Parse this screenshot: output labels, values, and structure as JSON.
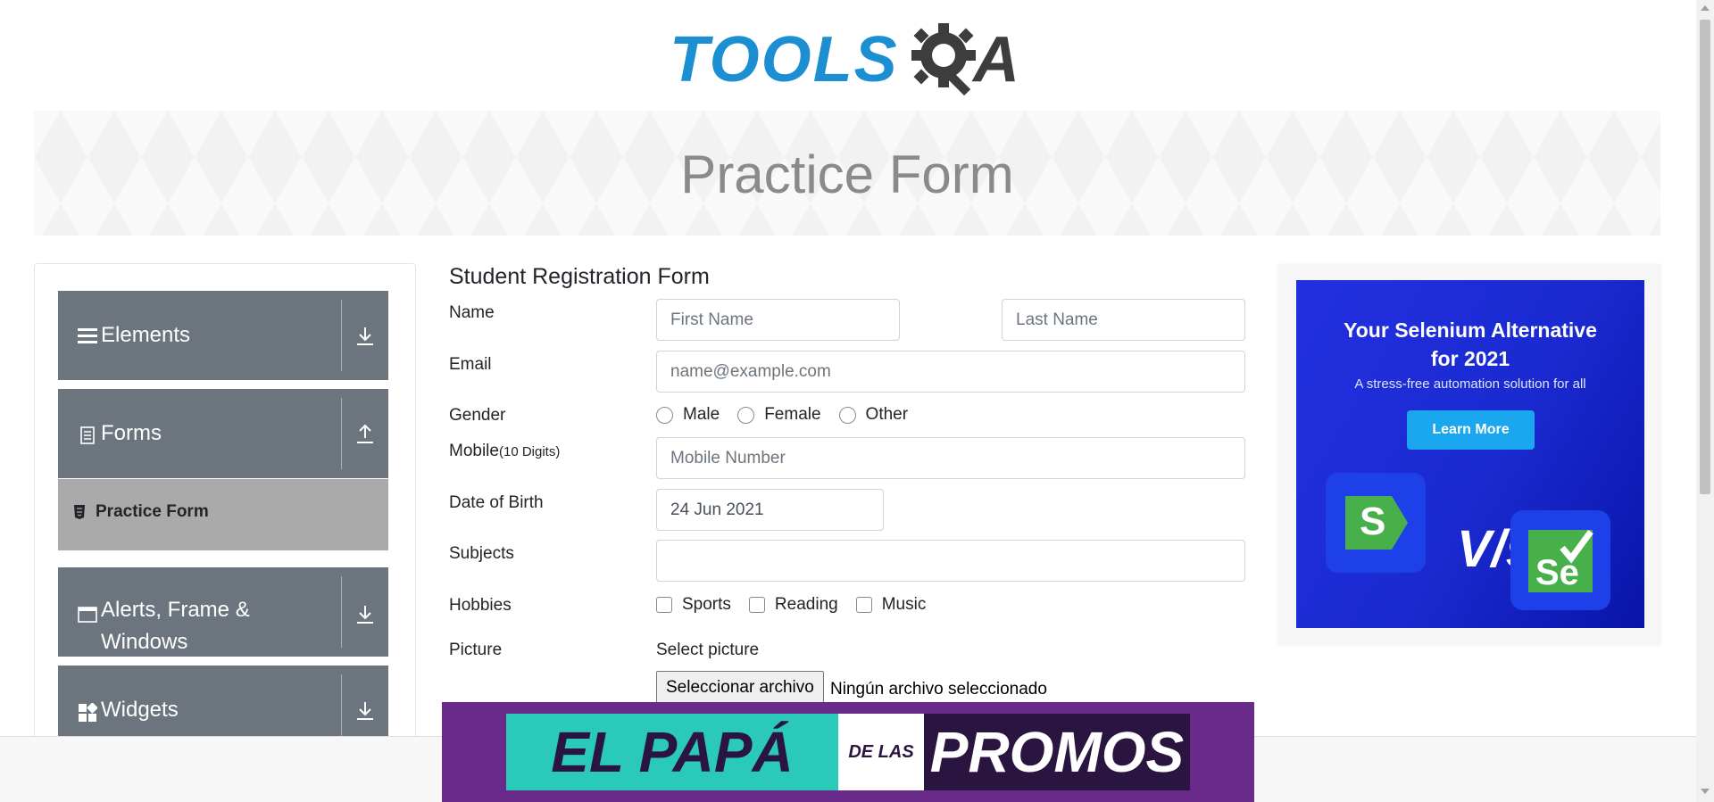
{
  "header": {
    "logo_text_left": "TOOLS",
    "logo_text_right": "A",
    "banner_title": "Practice Form"
  },
  "sidebar": {
    "groups": [
      {
        "label": "Elements",
        "icon": "hamburger-icon",
        "arrow": "download-arrow-icon"
      },
      {
        "label": "Forms",
        "icon": "document-icon",
        "arrow": "upload-arrow-icon"
      },
      {
        "label": "Alerts, Frame &",
        "label2": "Windows",
        "icon": "window-icon",
        "arrow": "download-arrow-icon"
      },
      {
        "label": "Widgets",
        "icon": "widgets-icon",
        "arrow": "download-arrow-icon"
      }
    ],
    "active_item": {
      "label": "Practice Form",
      "icon": "html5-icon"
    }
  },
  "form": {
    "title": "Student Registration Form",
    "name_label": "Name",
    "first_name_placeholder": "First Name",
    "last_name_placeholder": "Last Name",
    "email_label": "Email",
    "email_placeholder": "name@example.com",
    "gender_label": "Gender",
    "gender_options": [
      "Male",
      "Female",
      "Other"
    ],
    "mobile_label": "Mobile",
    "mobile_hint": "(10 Digits)",
    "mobile_placeholder": "Mobile Number",
    "dob_label": "Date of Birth",
    "dob_value": "24 Jun 2021",
    "subjects_label": "Subjects",
    "hobbies_label": "Hobbies",
    "hobby_options": [
      "Sports",
      "Reading",
      "Music"
    ],
    "picture_label": "Picture",
    "picture_prompt": "Select picture",
    "file_button": "Seleccionar archivo",
    "file_status": "Ningún archivo seleccionado"
  },
  "ad": {
    "title_line1": "Your Selenium Alternative",
    "title_line2": "for 2021",
    "subtitle": "A stress-free automation solution for all",
    "button": "Learn More",
    "vs_text": "V/s",
    "logo_left_letter": "S",
    "logo_right_letters": "Se"
  },
  "promo": {
    "part1": "EL PAPÁ",
    "part2": "DE LAS",
    "part3": "PROMOS"
  },
  "colors": {
    "sidebar_group_bg": "#6c757d",
    "active_item_bg": "#aaaaaa",
    "logo_blue": "#1b8fd1",
    "ad_bg": "#1a2ad0",
    "ad_button": "#1aa7f0",
    "promo_bg": "#6a2a8a"
  }
}
